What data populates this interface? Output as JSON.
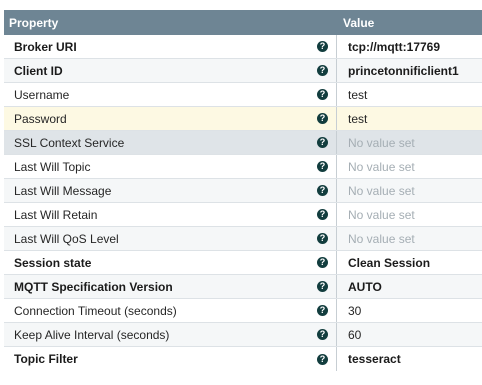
{
  "header": {
    "property": "Property",
    "value": "Value"
  },
  "help_glyph": "?",
  "rows": [
    {
      "name": "Broker URI",
      "value": "tcp://mqtt:17769",
      "required": true,
      "value_style": "set"
    },
    {
      "name": "Client ID",
      "value": "princetonnificlient1",
      "required": true,
      "value_style": "set"
    },
    {
      "name": "Username",
      "value": "test",
      "required": false,
      "value_style": "plain"
    },
    {
      "name": "Password",
      "value": "test",
      "required": false,
      "value_style": "plain",
      "highlight": "selected"
    },
    {
      "name": "SSL Context Service",
      "value": "No value set",
      "required": false,
      "value_style": "unset",
      "highlight": "disabled"
    },
    {
      "name": "Last Will Topic",
      "value": "No value set",
      "required": false,
      "value_style": "unset"
    },
    {
      "name": "Last Will Message",
      "value": "No value set",
      "required": false,
      "value_style": "unset"
    },
    {
      "name": "Last Will Retain",
      "value": "No value set",
      "required": false,
      "value_style": "unset"
    },
    {
      "name": "Last Will QoS Level",
      "value": "No value set",
      "required": false,
      "value_style": "unset"
    },
    {
      "name": "Session state",
      "value": "Clean Session",
      "required": true,
      "value_style": "set"
    },
    {
      "name": "MQTT Specification Version",
      "value": "AUTO",
      "required": true,
      "value_style": "set"
    },
    {
      "name": "Connection Timeout (seconds)",
      "value": "30",
      "required": false,
      "value_style": "plain"
    },
    {
      "name": "Keep Alive Interval (seconds)",
      "value": "60",
      "required": false,
      "value_style": "plain"
    },
    {
      "name": "Topic Filter",
      "value": "tesseract",
      "required": true,
      "value_style": "set"
    }
  ]
}
